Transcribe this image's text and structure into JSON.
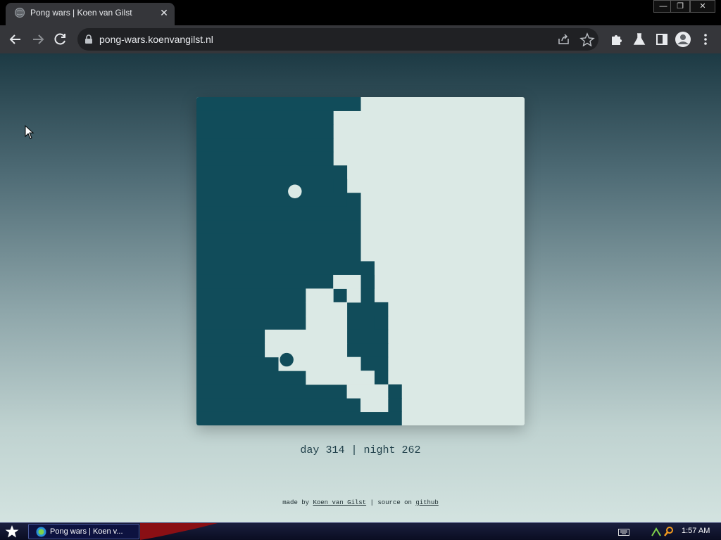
{
  "browser": {
    "tab": {
      "title": "Pong wars | Koen van Gilst",
      "favicon": "globe-icon",
      "close_icon": "close-icon"
    },
    "window_controls": {
      "minimize": "minimize-icon",
      "restore": "restore-icon",
      "close": "close-icon"
    },
    "toolbar": {
      "back_icon": "arrow-left-icon",
      "forward_icon": "arrow-right-icon",
      "reload_icon": "reload-icon",
      "lock_icon": "lock-icon",
      "url": "pong-wars.koenvangilst.nl",
      "share_icon": "share-icon",
      "bookmark_icon": "star-icon",
      "extensions_icon": "puzzle-icon",
      "labs_icon": "flask-icon",
      "side_panel_icon": "side-panel-icon",
      "profile_icon": "avatar-icon",
      "menu_icon": "kebab-menu-icon"
    }
  },
  "page": {
    "colors": {
      "day": "#dbe9e5",
      "night": "#114c5a"
    },
    "game": {
      "grid_size": 24,
      "night_columns": [
        [
          0,
          24
        ],
        [
          0,
          24
        ],
        [
          0,
          24
        ],
        [
          0,
          24
        ],
        [
          0,
          24
        ],
        [
          0,
          24
        ],
        [
          0,
          24
        ],
        [
          0,
          24
        ],
        [
          0,
          24
        ],
        [
          0,
          24
        ],
        [
          0,
          1
        ],
        [
          0,
          1
        ],
        [
          0,
          1
        ],
        [
          0,
          1
        ],
        [
          0,
          1
        ],
        [
          0,
          1
        ],
        [
          0,
          1
        ],
        [
          0,
          1
        ],
        [
          0,
          1
        ],
        [
          0,
          1
        ],
        [
          0,
          1
        ],
        [
          0,
          1
        ],
        [
          0,
          1
        ],
        [
          0,
          1
        ]
      ],
      "balls": [
        {
          "team": "day",
          "col": 7.2,
          "row": 6.9
        },
        {
          "team": "night",
          "col": 6.6,
          "row": 19.2
        }
      ]
    },
    "score": {
      "day_label": "day",
      "day": "314",
      "separator": "|",
      "night_label": "night",
      "night": "262"
    },
    "footer": {
      "made_by": "made by",
      "author": "Koen van Gilst",
      "separator": "|",
      "source_on": "source on",
      "github": "github"
    }
  },
  "taskbar": {
    "start_icon": "star-icon",
    "task_label": "Pong wars | Koen v...",
    "task_icon": "globe-icon",
    "tray": {
      "keyboard_icon": "keyboard-icon",
      "network_icon": "network-icon",
      "search_icon": "magnifier-icon"
    },
    "clock": "1:57 AM"
  }
}
